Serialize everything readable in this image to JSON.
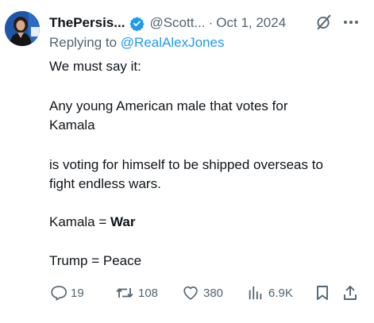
{
  "author": {
    "display_name": "ThePersis...",
    "handle": "@Scott...",
    "separator": "·",
    "date": "Oct 1, 2024"
  },
  "reply": {
    "prefix": "Replying to",
    "handle": "@RealAlexJones"
  },
  "body": {
    "line1": "We must say it:",
    "line2": "Any young American male that votes for",
    "line3": "Kamala",
    "line4": "is voting for himself to be shipped overseas to",
    "line5": "fight endless wars.",
    "line6_prefix": "Kamala = ",
    "line6_bold": "War",
    "line7": "Trump = Peace"
  },
  "actions": {
    "replies": "19",
    "reposts": "108",
    "likes": "380",
    "views": "6.9K"
  },
  "icons": {
    "verified": "verified-badge-icon",
    "grok": "grok-icon",
    "more": "more-icon",
    "reply": "reply-icon",
    "repost": "repost-icon",
    "like": "heart-icon",
    "views": "views-chart-icon",
    "bookmark": "bookmark-icon",
    "share": "share-icon"
  },
  "colors": {
    "text": "#0f1419",
    "secondary": "#536471",
    "link": "#1d9bf0",
    "verified": "#1d9bf0"
  }
}
